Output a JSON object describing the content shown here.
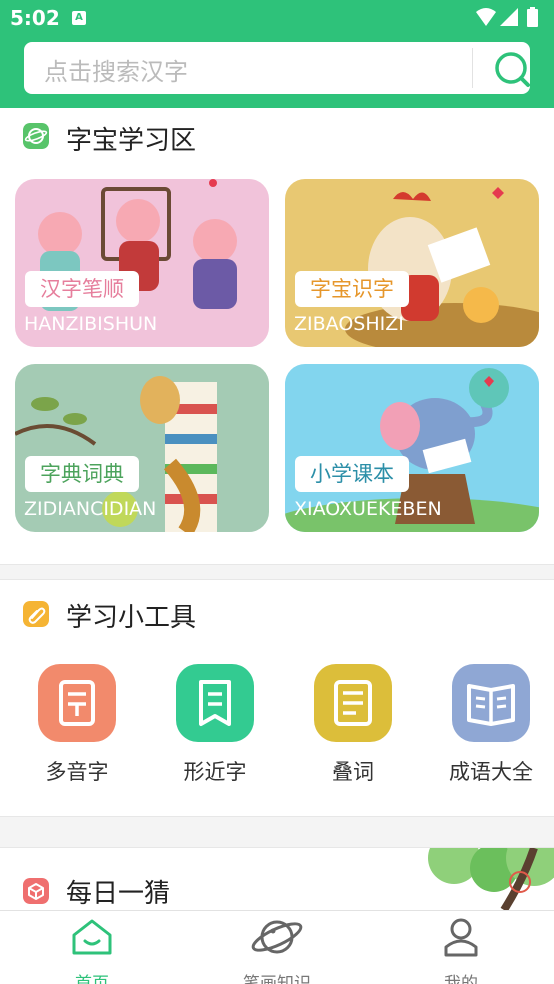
{
  "status": {
    "time": "5:02",
    "badge": "A"
  },
  "search": {
    "placeholder": "点击搜索汉字"
  },
  "study_zone": {
    "title": "字宝学习区",
    "cards": [
      {
        "label": "汉字笔顺",
        "subtitle": "HANZIBISHUN",
        "label_color": "#e67e9c"
      },
      {
        "label": "字宝识字",
        "subtitle": "ZIBAOSHIZI",
        "label_color": "#e6962a"
      },
      {
        "label": "字典词典",
        "subtitle": "ZIDIANCIDIAN",
        "label_color": "#4ca35c"
      },
      {
        "label": "小学课本",
        "subtitle": "XIAOXUEKEBEN",
        "label_color": "#2c8fa8"
      }
    ]
  },
  "tools": {
    "title": "学习小工具",
    "items": [
      {
        "label": "多音字",
        "icon": "document-icon",
        "color": "#f28a6c"
      },
      {
        "label": "形近字",
        "icon": "bookmark-icon",
        "color": "#33cb91"
      },
      {
        "label": "叠词",
        "icon": "notes-icon",
        "color": "#dcbe3a"
      },
      {
        "label": "成语大全",
        "icon": "open-book-icon",
        "color": "#8fa7d4"
      }
    ]
  },
  "daily": {
    "title": "每日一猜"
  },
  "nav": [
    {
      "label": "首页",
      "icon": "home-icon"
    },
    {
      "label": "笔画知识",
      "icon": "planet-icon"
    },
    {
      "label": "我的",
      "icon": "person-icon"
    }
  ],
  "colors": {
    "brand": "#2ec27a"
  }
}
